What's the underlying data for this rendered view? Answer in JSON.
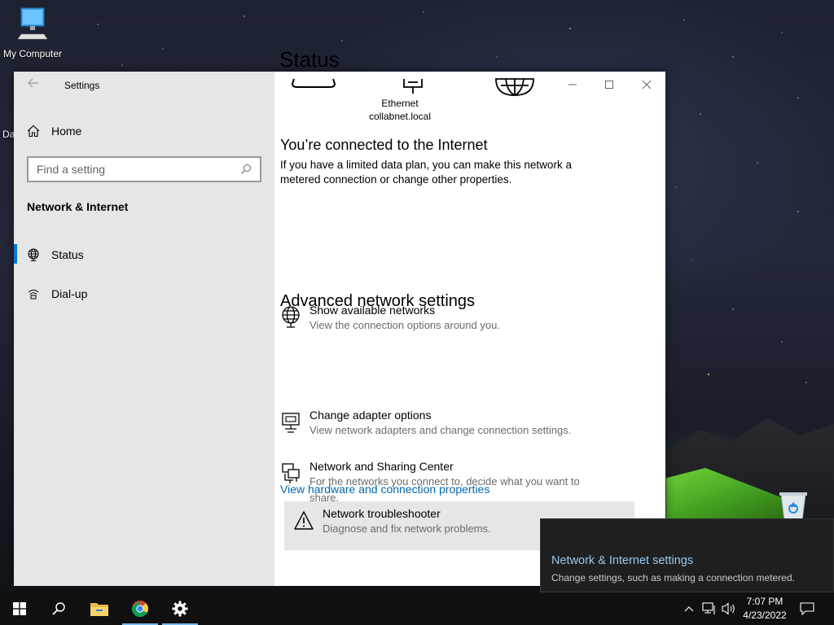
{
  "desktop": {
    "icons": [
      {
        "label": "My Computer",
        "icon": "computer-icon"
      }
    ],
    "partial_label": "Da"
  },
  "window": {
    "title": "Settings",
    "controls": [
      "minimize",
      "maximize",
      "close"
    ]
  },
  "sidebar": {
    "home_label": "Home",
    "search_placeholder": "Find a setting",
    "section_title": "Network & Internet",
    "items": [
      {
        "label": "Status",
        "icon": "globe-icon",
        "active": true
      },
      {
        "label": "Dial-up",
        "icon": "dialup-icon",
        "active": false
      }
    ]
  },
  "main": {
    "title": "Status",
    "network_diagram": {
      "connection_name": "Ethernet",
      "connection_domain": "collabnet.local"
    },
    "connected_heading": "You’re connected to the Internet",
    "connected_text": "If you have a limited data plan, you can make this network a metered connection or change other properties.",
    "show_networks": {
      "title": "Show available networks",
      "desc": "View the connection options around you."
    },
    "advanced_heading": "Advanced network settings",
    "advanced_items": [
      {
        "title": "Change adapter options",
        "desc": "View network adapters and change connection settings.",
        "icon": "adapter-icon"
      },
      {
        "title": "Network and Sharing Center",
        "desc": "For the networks you connect to, decide what you want to share.",
        "icon": "sharing-center-icon"
      },
      {
        "title": "Network troubleshooter",
        "desc": "Diagnose and fix network problems.",
        "icon": "warning-icon"
      }
    ],
    "hardware_link": "View hardware and connection properties"
  },
  "flyout": {
    "title": "Network & Internet settings",
    "desc": "Change settings, such as making a connection metered."
  },
  "taskbar": {
    "time": "7:07 PM",
    "date": "4/23/2022",
    "apps": [
      "start",
      "search",
      "file-explorer",
      "chrome",
      "settings"
    ]
  },
  "colors": {
    "accent": "#0078d7",
    "link": "#0067b8",
    "flyout_link": "#99c9ef"
  }
}
